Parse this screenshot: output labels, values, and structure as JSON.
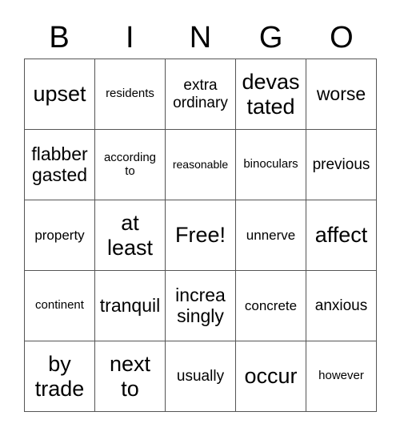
{
  "header": [
    "B",
    "I",
    "N",
    "G",
    "O"
  ],
  "cells": [
    [
      "upset",
      "residents",
      "extra\nordinary",
      "devas\ntated",
      "worse"
    ],
    [
      "flabber\ngasted",
      "according\nto",
      "reasonable",
      "binoculars",
      "previous"
    ],
    [
      "property",
      "at\nleast",
      "Free!",
      "unnerve",
      "affect"
    ],
    [
      "continent",
      "tranquil",
      "increa\nsingly",
      "concrete",
      "anxious"
    ],
    [
      "by\ntrade",
      "next\nto",
      "usually",
      "occur",
      "however"
    ]
  ]
}
